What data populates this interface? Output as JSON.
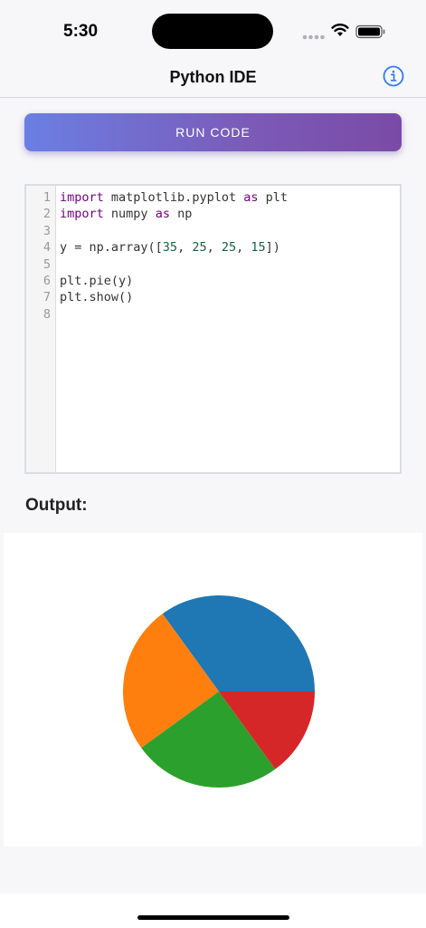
{
  "status_bar": {
    "time": "5:30"
  },
  "nav": {
    "title": "Python IDE",
    "info_icon": "info-circle-icon"
  },
  "run_button": {
    "label": "RUN CODE"
  },
  "editor": {
    "line_numbers": [
      "1",
      "2",
      "3",
      "4",
      "5",
      "6",
      "7",
      "8"
    ],
    "lines": [
      [
        {
          "t": "import",
          "c": "kw"
        },
        {
          "t": " matplotlib.pyplot ",
          "c": ""
        },
        {
          "t": "as",
          "c": "kw"
        },
        {
          "t": " plt",
          "c": ""
        }
      ],
      [
        {
          "t": "import",
          "c": "kw"
        },
        {
          "t": " numpy ",
          "c": ""
        },
        {
          "t": "as",
          "c": "kw"
        },
        {
          "t": " np",
          "c": ""
        }
      ],
      [],
      [
        {
          "t": "y = np.array([",
          "c": ""
        },
        {
          "t": "35",
          "c": "num"
        },
        {
          "t": ", ",
          "c": ""
        },
        {
          "t": "25",
          "c": "num"
        },
        {
          "t": ", ",
          "c": ""
        },
        {
          "t": "25",
          "c": "num"
        },
        {
          "t": ", ",
          "c": ""
        },
        {
          "t": "15",
          "c": "num"
        },
        {
          "t": "])",
          "c": ""
        }
      ],
      [],
      [
        {
          "t": "plt.pie(y)",
          "c": ""
        }
      ],
      [
        {
          "t": "plt.show()",
          "c": ""
        }
      ],
      []
    ]
  },
  "output": {
    "label": "Output:"
  },
  "chart_data": {
    "type": "pie",
    "values": [
      35,
      25,
      25,
      15
    ],
    "colors": [
      "#1f77b4",
      "#ff7f0e",
      "#2ca02c",
      "#d62728"
    ],
    "start_angle_deg": 0,
    "direction": "counterclockwise"
  }
}
